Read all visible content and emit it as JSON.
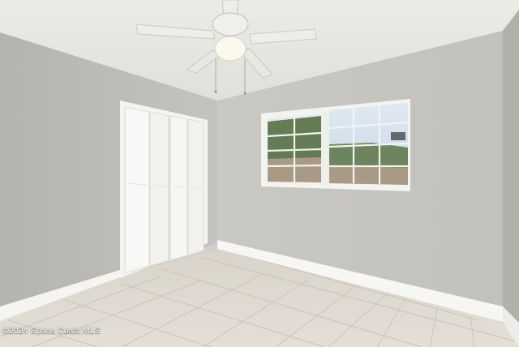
{
  "photo": {
    "watermark": "©2024 Space Coast MLS"
  },
  "colors": {
    "ceiling": "#e6e5e0",
    "wall_left": "#bdbcb7",
    "wall_back": "#c7c6c1",
    "floor": "#e0dbd2",
    "trim": "#f7f7f4"
  }
}
